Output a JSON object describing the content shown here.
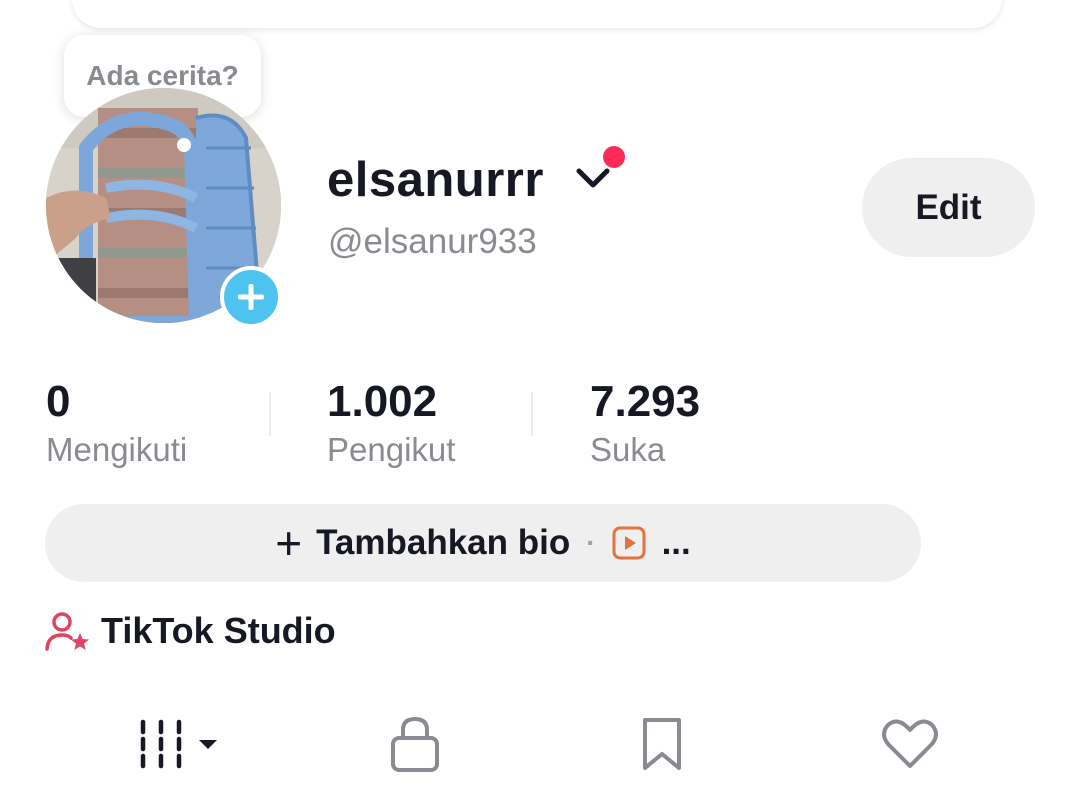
{
  "story": {
    "prompt": "Ada cerita?"
  },
  "profile": {
    "username": "elsanurrr",
    "handle": "@elsanur933",
    "edit_label": "Edit"
  },
  "stats": [
    {
      "value": "0",
      "label": "Mengikuti"
    },
    {
      "value": "1.002",
      "label": "Pengikut"
    },
    {
      "value": "7.293",
      "label": "Suka"
    }
  ],
  "bio": {
    "add_label": "Tambahkan bio",
    "more": "..."
  },
  "studio": {
    "label": "TikTok Studio"
  },
  "tabs": [
    {
      "icon": "grid-icon",
      "name": "videos"
    },
    {
      "icon": "lock-icon",
      "name": "private"
    },
    {
      "icon": "bookmark-icon",
      "name": "saved"
    },
    {
      "icon": "heart-icon",
      "name": "liked"
    }
  ],
  "colors": {
    "accent_red": "#fe2c55",
    "story_blue": "#4fc3ef",
    "muted_text": "#8a8b91",
    "button_bg": "#efefef"
  }
}
